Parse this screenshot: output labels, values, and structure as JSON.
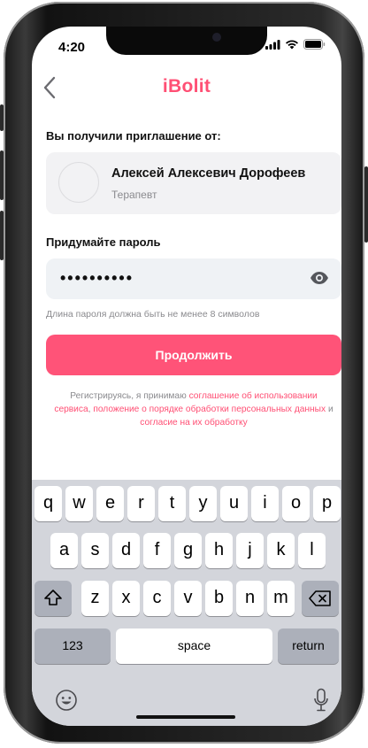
{
  "status_bar": {
    "time": "4:20",
    "icons": [
      "cellular-signal-icon",
      "wifi-icon",
      "battery-icon"
    ]
  },
  "header": {
    "back_icon": "chevron-left-icon",
    "logo": "iBolit"
  },
  "invitation": {
    "label": "Вы получили приглашение от:",
    "name": "Алексей Алексевич Дорофеев",
    "role": "Терапевт"
  },
  "password": {
    "label": "Придумайте пароль",
    "value": "••••••••••",
    "hint": "Длина пароля должна быть не менее 8 символов",
    "toggle_icon": "eye-icon"
  },
  "continue_label": "Продолжить",
  "terms": {
    "prefix": "Регистрируясь, я принимаю ",
    "link1": "соглашение об использовании сервиса",
    "sep1": ", ",
    "link2": "положение о порядке обработки персональных данных",
    "sep2": " и ",
    "link3": "согласие на их обработку"
  },
  "keyboard": {
    "row1": [
      "q",
      "w",
      "e",
      "r",
      "t",
      "y",
      "u",
      "i",
      "o",
      "p"
    ],
    "row2": [
      "a",
      "s",
      "d",
      "f",
      "g",
      "h",
      "j",
      "k",
      "l"
    ],
    "row3": [
      "z",
      "x",
      "c",
      "v",
      "b",
      "n",
      "m"
    ],
    "numbers_label": "123",
    "space_label": "space",
    "return_label": "return"
  },
  "colors": {
    "accent": "#ff4f74",
    "button": "#ff5378",
    "field_bg": "#eff2f5",
    "keyboard_bg": "#d3d5db"
  }
}
